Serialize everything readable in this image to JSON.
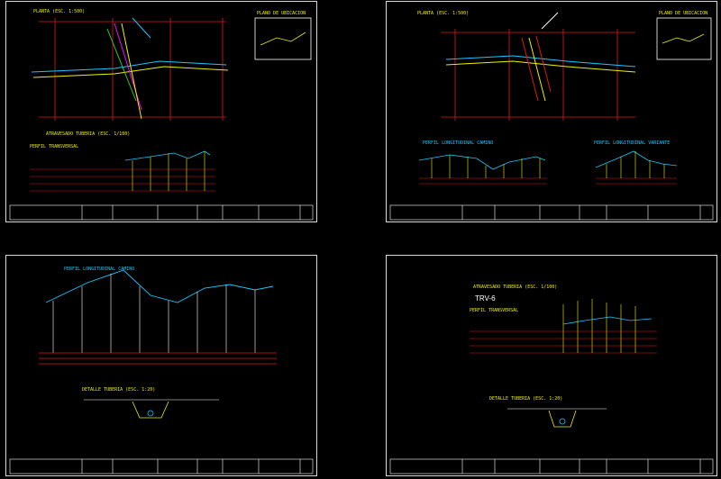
{
  "colors": {
    "background": "#000000",
    "frame": "#d9d9d9",
    "red": "#e01818",
    "yellow": "#f0f000",
    "cyan": "#19c8ff",
    "magenta": "#ff00ff",
    "green": "#2ec82e",
    "white": "#ffffff"
  },
  "sheets": [
    {
      "plan_title": "PLANTA (ESC. 1:500)",
      "location_title": "PLANO DE UBICACION",
      "crossing_title": "ATRAVESADO TUBERIA (ESC. 1/100)",
      "section_title": "PERFIL TRANSVERSAL"
    },
    {
      "plan_title": "PLANTA (ESC. 1:500)",
      "location_title": "PLANO DE UBICACION",
      "profile_left_title": "PERFIL LONGITUDINAL CAMINO",
      "profile_right_title": "PERFIL LONGITUDINAL VARIANTE"
    },
    {
      "profile_title": "PERFIL LONGITUDINAL CAMINO",
      "detail_title": "DETALLE TUBERIA (ESC. 1:20)"
    },
    {
      "crossing_title": "ATRAVESADO TUBERIA (ESC. 1/100)",
      "trv_label": "TRV-6",
      "section_title": "PERFIL TRANSVERSAL",
      "detail_title": "DETALLE TUBERIA (ESC. 1:20)"
    }
  ]
}
